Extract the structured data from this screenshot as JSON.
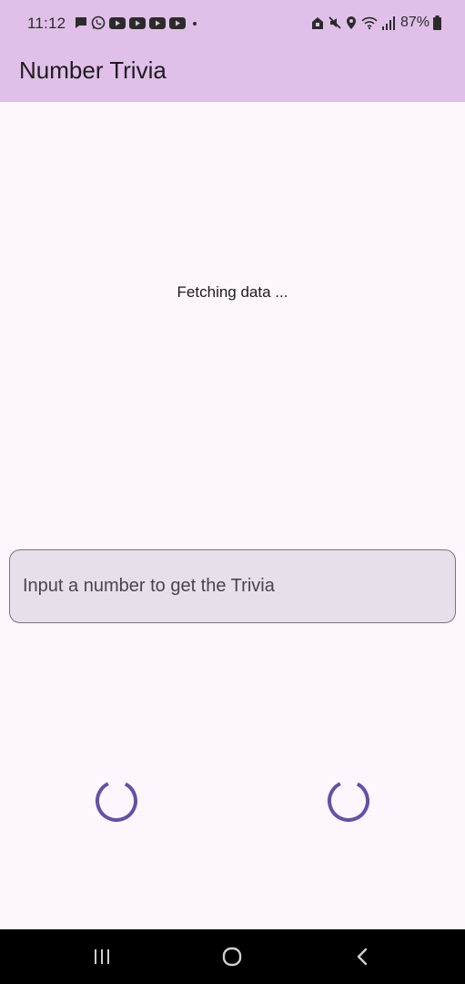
{
  "status_bar": {
    "time": "11:12",
    "battery": "87%",
    "left_icons": [
      "chat-icon",
      "whatsapp-icon",
      "youtube-icon",
      "youtube-icon",
      "youtube-icon",
      "youtube-icon",
      "dot-icon"
    ],
    "right_icons": [
      "lock-icon",
      "mute-icon",
      "location-icon",
      "wifi-icon",
      "signal-icon",
      "battery-icon"
    ]
  },
  "app_bar": {
    "title": "Number Trivia",
    "background": "#e0c0e8"
  },
  "main": {
    "status_message": "Fetching data ...",
    "input_placeholder": "Input a number to get the Trivia",
    "accent_color": "#6750a4"
  },
  "nav_bar": {
    "buttons": [
      "recents-icon",
      "home-icon",
      "back-icon"
    ]
  }
}
